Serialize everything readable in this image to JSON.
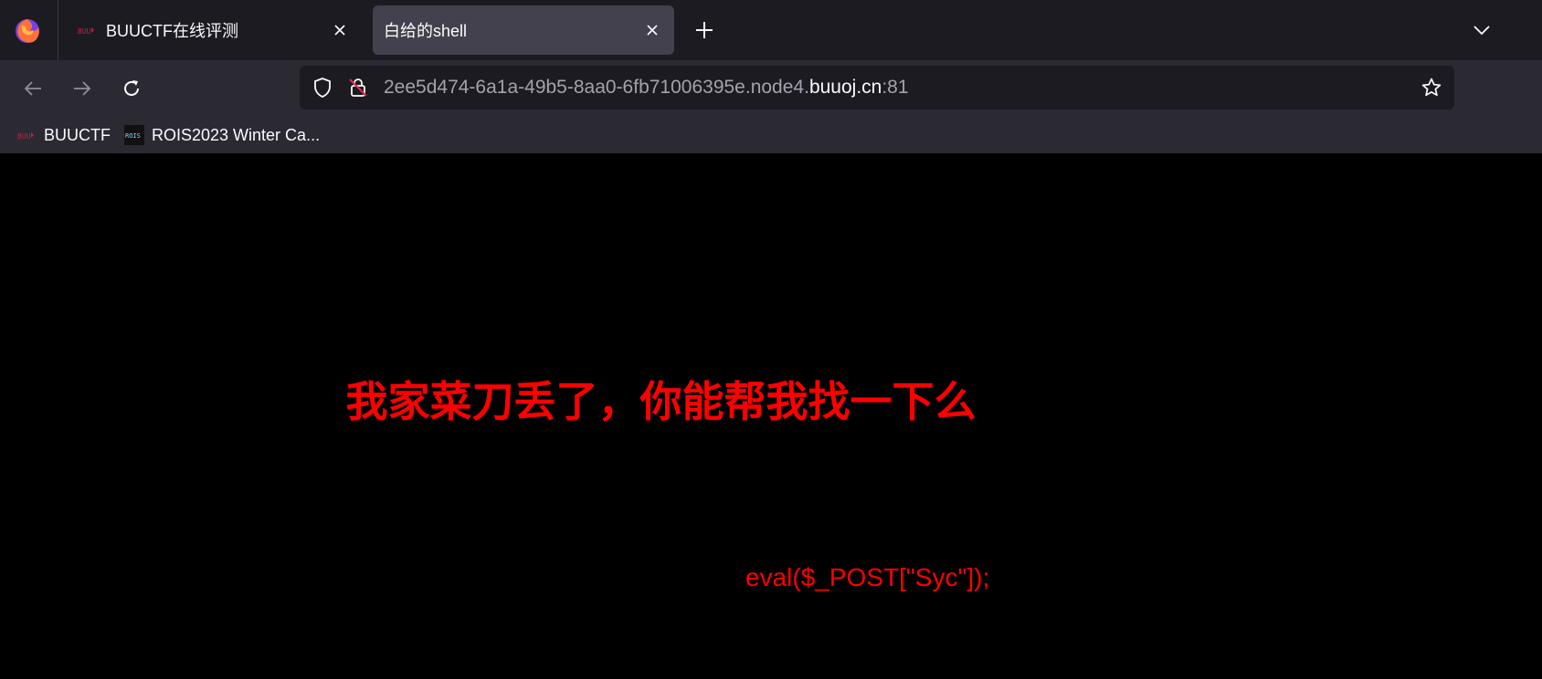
{
  "browser": {
    "tabs": [
      {
        "title": "BUUCTF在线评测",
        "active": false,
        "favicon": "buuctf-favicon"
      },
      {
        "title": "白给的shell",
        "active": true,
        "favicon": "none"
      }
    ],
    "new_tab_icon": "plus-icon",
    "list_all_tabs_icon": "chevron-down-icon"
  },
  "navbar": {
    "back_icon": "arrow-left-icon",
    "forward_icon": "arrow-right-icon",
    "reload_icon": "reload-icon",
    "url": {
      "prefix": "2ee5d474-6a1a-49b5-8aa0-6fb71006395e.node4.",
      "host": "buuoj.cn",
      "suffix": ":81"
    },
    "tracking_protection_icon": "shield-icon",
    "insecure_lock_icon": "lock-insecure-icon",
    "bookmark_star_icon": "star-icon"
  },
  "bookmarks": [
    {
      "label": "BUUCTF",
      "icon": "buuctf-favicon"
    },
    {
      "label": "ROIS2023 Winter Ca...",
      "icon": "rois-favicon"
    }
  ],
  "page": {
    "heading": "我家菜刀丢了，你能帮我找一下么",
    "code": "eval($_POST[\"Syc\"]);"
  },
  "colors": {
    "tabstrip_bg": "#1c1b22",
    "toolbar_bg": "#2b2a33",
    "active_tab_bg": "#42414d",
    "page_bg": "#000000",
    "page_text": "#ff0000"
  }
}
